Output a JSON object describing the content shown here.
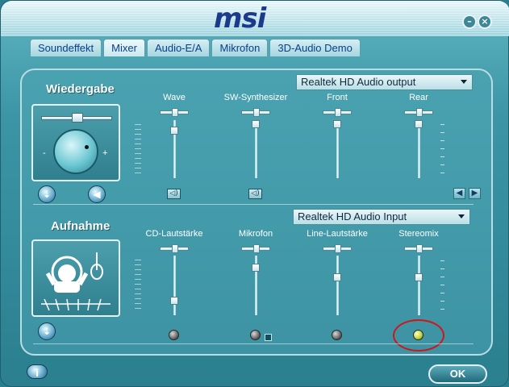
{
  "header": {
    "logo": "msi",
    "minimize": "–",
    "close": "×"
  },
  "tabs": [
    {
      "label": "Soundeffekt"
    },
    {
      "label": "Mixer"
    },
    {
      "label": "Audio-E/A"
    },
    {
      "label": "Mikrofon"
    },
    {
      "label": "3D-Audio Demo"
    }
  ],
  "active_tab": "Mixer",
  "playback": {
    "title": "Wiedergabe",
    "knob_minus": "-",
    "knob_plus": "+",
    "device": "Realtek HD Audio output",
    "channels": [
      {
        "label": "Wave",
        "level": 0.87
      },
      {
        "label": "SW-Synthesizer",
        "level": 1.0
      },
      {
        "label": "Front",
        "level": 1.0
      },
      {
        "label": "Rear",
        "level": 1.0
      }
    ]
  },
  "recording": {
    "title": "Aufnahme",
    "device": "Realtek HD Audio Input",
    "channels": [
      {
        "label": "CD-Lautstärke",
        "level": 0.2,
        "selected": false
      },
      {
        "label": "Mikrofon",
        "level": 0.85,
        "selected": false
      },
      {
        "label": "Line-Lautstärke",
        "level": 0.65,
        "selected": false
      },
      {
        "label": "Stereomix",
        "level": 0.65,
        "selected": true
      }
    ],
    "highlight_color": "#d0151b"
  },
  "colors": {
    "accent": "#1b3a8c",
    "panel": "#4aa2b1",
    "led_on": "#c5d83c"
  },
  "footer": {
    "info": "i",
    "ok": "OK"
  }
}
